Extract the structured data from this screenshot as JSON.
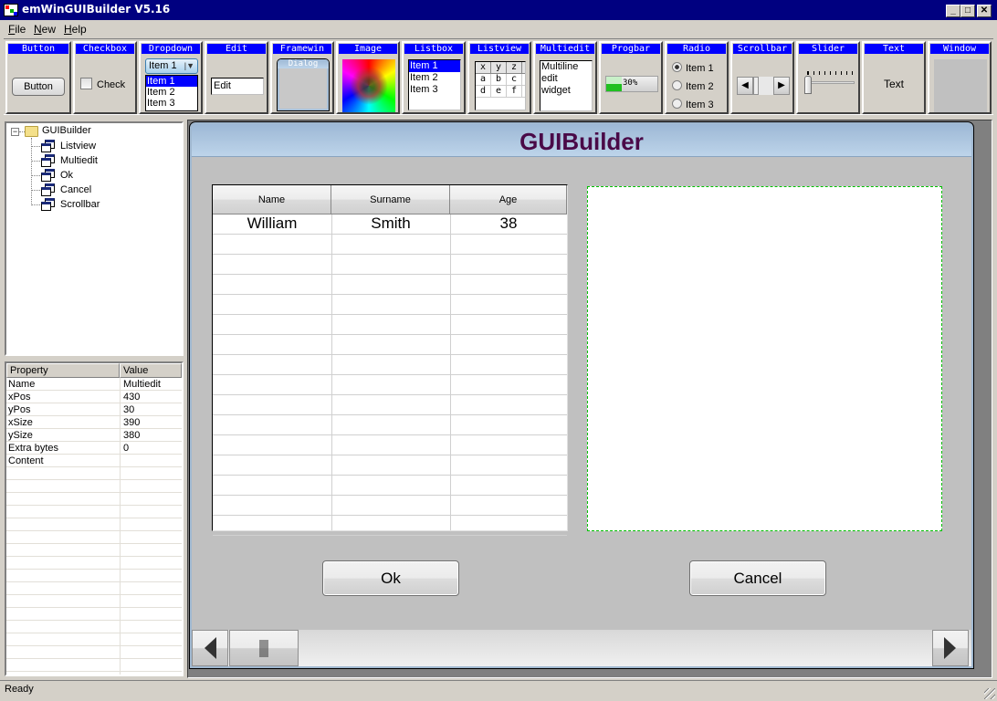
{
  "app": {
    "title": "emWinGUIBuilder V5.16",
    "window_buttons": {
      "minimize": "_",
      "maximize": "□",
      "close": "✕"
    }
  },
  "menu": [
    {
      "label": "File",
      "accel": "F",
      "rest": "ile"
    },
    {
      "label": "New",
      "accel": "N",
      "rest": "ew"
    },
    {
      "label": "Help",
      "accel": "H",
      "rest": "elp"
    }
  ],
  "toolbar": {
    "button": {
      "header": "Button",
      "sample": "Button"
    },
    "checkbox": {
      "header": "Checkbox",
      "sample": "Check"
    },
    "dropdown": {
      "header": "Dropdown",
      "selected": "Item 1",
      "items": [
        "Item 1",
        "Item 2",
        "Item 3"
      ]
    },
    "edit": {
      "header": "Edit",
      "sample": "Edit"
    },
    "framewin": {
      "header": "Framewin",
      "sample": "Dialog"
    },
    "image": {
      "header": "Image"
    },
    "listbox": {
      "header": "Listbox",
      "items": [
        "Item 1",
        "Item 2",
        "Item 3"
      ]
    },
    "listview": {
      "header": "Listview",
      "columns": [
        "x",
        "y",
        "z"
      ],
      "rows": [
        [
          "a",
          "b",
          "c"
        ],
        [
          "d",
          "e",
          "f"
        ]
      ]
    },
    "multiedit": {
      "header": "Multiedit",
      "lines": [
        "Multiline",
        "edit",
        "widget"
      ]
    },
    "progbar": {
      "header": "Progbar",
      "value_percent": 30,
      "label": "30%"
    },
    "radio": {
      "header": "Radio",
      "items": [
        "Item 1",
        "Item 2",
        "Item 3"
      ],
      "selected_index": 0
    },
    "scrollbar": {
      "header": "Scrollbar"
    },
    "slider": {
      "header": "Slider"
    },
    "text": {
      "header": "Text",
      "sample": "Text"
    },
    "window": {
      "header": "Window"
    }
  },
  "tree": {
    "root": "GUIBuilder",
    "children": [
      "Listview",
      "Multiedit",
      "Ok",
      "Cancel",
      "Scrollbar"
    ]
  },
  "properties": {
    "headers": [
      "Property",
      "Value"
    ],
    "rows": [
      [
        "Name",
        "Multiedit"
      ],
      [
        "xPos",
        "430"
      ],
      [
        "yPos",
        "30"
      ],
      [
        "xSize",
        "390"
      ],
      [
        "ySize",
        "380"
      ],
      [
        "Extra bytes",
        "0"
      ],
      [
        "Content",
        ""
      ]
    ]
  },
  "dialog": {
    "title": "GUIBuilder",
    "listview": {
      "columns": [
        "Name",
        "Surname",
        "Age"
      ],
      "rows": [
        [
          "William",
          "Smith",
          "38"
        ]
      ]
    },
    "ok_label": "Ok",
    "cancel_label": "Cancel"
  },
  "status": {
    "text": "Ready"
  }
}
